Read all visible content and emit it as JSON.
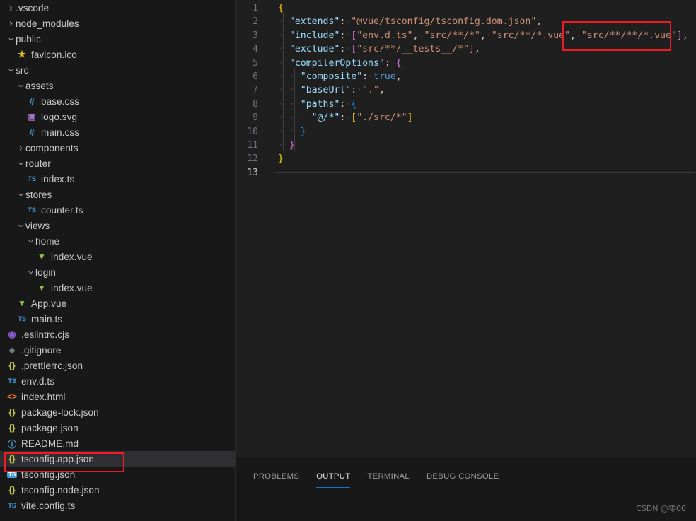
{
  "window": {
    "accent_color": "#0078d4",
    "annotation_color": "#ee1c25",
    "background": "#1e1e1e"
  },
  "sidebar": {
    "items": [
      {
        "label": ".vscode",
        "icon": "chevron-right-icon",
        "kind": "folder-collapsed",
        "indent": 1
      },
      {
        "label": "node_modules",
        "icon": "chevron-right-icon",
        "kind": "folder-collapsed",
        "indent": 1
      },
      {
        "label": "public",
        "icon": "chevron-down-icon",
        "kind": "folder-expanded",
        "indent": 1
      },
      {
        "label": "favicon.ico",
        "icon": "star-icon",
        "kind": "file-ico",
        "indent": 2
      },
      {
        "label": "src",
        "icon": "chevron-down-icon",
        "kind": "folder-expanded",
        "indent": 1
      },
      {
        "label": "assets",
        "icon": "chevron-down-icon",
        "kind": "folder-expanded",
        "indent": 2
      },
      {
        "label": "base.css",
        "icon": "hash-icon",
        "kind": "file-css",
        "indent": 3
      },
      {
        "label": "logo.svg",
        "icon": "svg-icon",
        "kind": "file-svg",
        "indent": 3
      },
      {
        "label": "main.css",
        "icon": "hash-icon",
        "kind": "file-css",
        "indent": 3
      },
      {
        "label": "components",
        "icon": "chevron-right-icon",
        "kind": "folder-collapsed",
        "indent": 2
      },
      {
        "label": "router",
        "icon": "chevron-down-icon",
        "kind": "folder-expanded",
        "indent": 2
      },
      {
        "label": "index.ts",
        "icon": "ts-icon",
        "kind": "file-ts",
        "indent": 3
      },
      {
        "label": "stores",
        "icon": "chevron-down-icon",
        "kind": "folder-expanded",
        "indent": 2
      },
      {
        "label": "counter.ts",
        "icon": "ts-icon",
        "kind": "file-ts",
        "indent": 3
      },
      {
        "label": "views",
        "icon": "chevron-down-icon",
        "kind": "folder-expanded",
        "indent": 2
      },
      {
        "label": "home",
        "icon": "chevron-down-icon",
        "kind": "folder-expanded",
        "indent": 3
      },
      {
        "label": "index.vue",
        "icon": "vue-icon",
        "kind": "file-vue",
        "indent": 4
      },
      {
        "label": "login",
        "icon": "chevron-down-icon",
        "kind": "folder-expanded",
        "indent": 3
      },
      {
        "label": "index.vue",
        "icon": "vue-icon",
        "kind": "file-vue",
        "indent": 4
      },
      {
        "label": "App.vue",
        "icon": "vue-icon",
        "kind": "file-vue",
        "indent": 2
      },
      {
        "label": "main.ts",
        "icon": "ts-icon",
        "kind": "file-ts",
        "indent": 2
      },
      {
        "label": ".eslintrc.cjs",
        "icon": "eslint-icon",
        "kind": "file-eslint",
        "indent": 1
      },
      {
        "label": ".gitignore",
        "icon": "git-icon",
        "kind": "file-git",
        "indent": 1
      },
      {
        "label": ".prettierrc.json",
        "icon": "json-icon",
        "kind": "file-json",
        "indent": 1
      },
      {
        "label": "env.d.ts",
        "icon": "ts-icon",
        "kind": "file-ts",
        "indent": 1
      },
      {
        "label": "index.html",
        "icon": "html-icon",
        "kind": "file-html",
        "indent": 1
      },
      {
        "label": "package-lock.json",
        "icon": "json-icon",
        "kind": "file-json",
        "indent": 1
      },
      {
        "label": "package.json",
        "icon": "json-icon",
        "kind": "file-json",
        "indent": 1
      },
      {
        "label": "README.md",
        "icon": "info-icon",
        "kind": "file-md",
        "indent": 1
      },
      {
        "label": "tsconfig.app.json",
        "icon": "json-icon",
        "kind": "file-json",
        "indent": 1,
        "selected": true,
        "annotated": true
      },
      {
        "label": "tsconfig.json",
        "icon": "tsbox-icon",
        "kind": "file-tsconfig",
        "indent": 1
      },
      {
        "label": "tsconfig.node.json",
        "icon": "json-icon",
        "kind": "file-json",
        "indent": 1
      },
      {
        "label": "vite.config.ts",
        "icon": "ts-icon",
        "kind": "file-ts",
        "indent": 1
      }
    ]
  },
  "editor": {
    "language": "json",
    "active_line": 13,
    "line_numbers": [
      "1",
      "2",
      "3",
      "4",
      "5",
      "6",
      "7",
      "8",
      "9",
      "10",
      "11",
      "12",
      "13"
    ],
    "lines": [
      {
        "n": "1",
        "content": "{"
      },
      {
        "n": "2",
        "content": "  \"extends\": \"@vue/tsconfig/tsconfig.dom.json\","
      },
      {
        "n": "3",
        "content": "  \"include\": [\"env.d.ts\", \"src/**/*\", \"src/**/*.vue\", \"src/**/**/*.vue\"],"
      },
      {
        "n": "4",
        "content": "  \"exclude\": [\"src/**/__tests__/*\"],"
      },
      {
        "n": "5",
        "content": "  \"compilerOptions\": {"
      },
      {
        "n": "6",
        "content": "    \"composite\": true,"
      },
      {
        "n": "7",
        "content": "    \"baseUrl\": \".\","
      },
      {
        "n": "8",
        "content": "    \"paths\": {"
      },
      {
        "n": "9",
        "content": "      \"@/*\": [\"./src/*\"]"
      },
      {
        "n": "10",
        "content": "    }"
      },
      {
        "n": "11",
        "content": "  }"
      },
      {
        "n": "12",
        "content": "}"
      },
      {
        "n": "13",
        "content": ""
      }
    ],
    "annotation_target": "\"src/**/**/*.vue\""
  },
  "panel": {
    "tabs": [
      {
        "label": "PROBLEMS",
        "active": false
      },
      {
        "label": "OUTPUT",
        "active": true
      },
      {
        "label": "TERMINAL",
        "active": false
      },
      {
        "label": "DEBUG CONSOLE",
        "active": false
      }
    ],
    "watermark": "CSDN @零00"
  }
}
